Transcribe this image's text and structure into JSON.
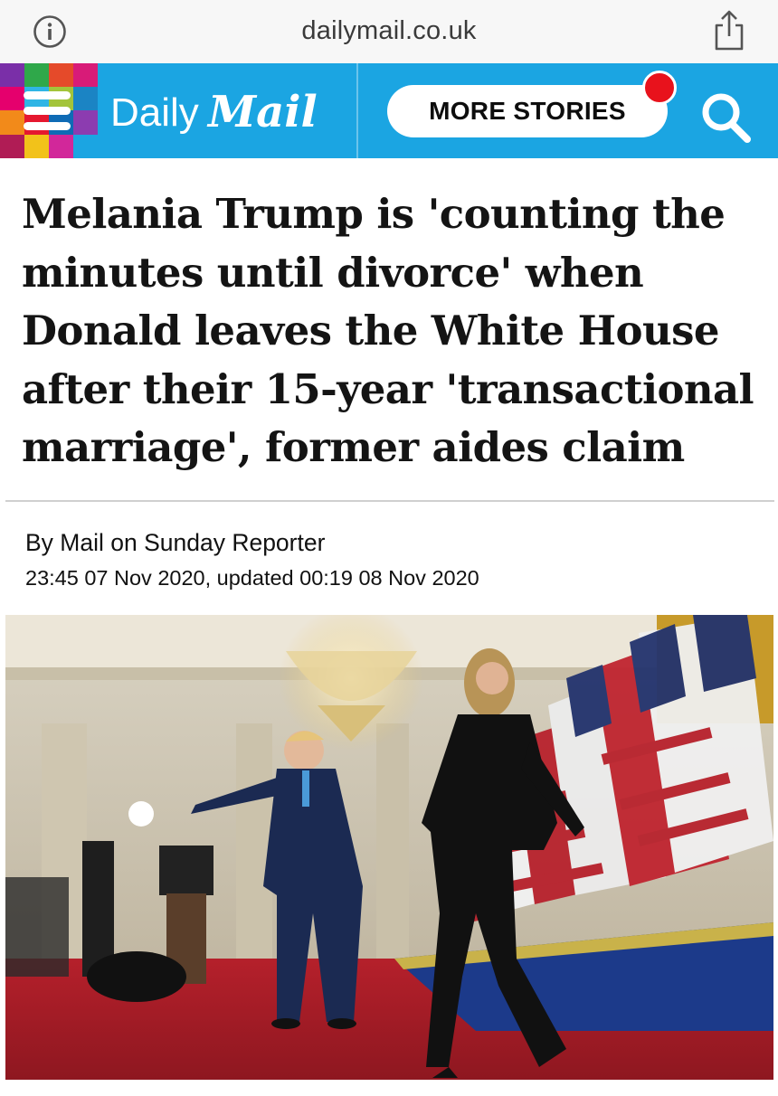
{
  "browser": {
    "url": "dailymail.co.uk"
  },
  "header": {
    "brand": "Daily Mail",
    "brand_part1": "Daily",
    "brand_part2": "Mail",
    "more_stories_label": "MORE STORIES",
    "accent_color": "#1ba5e2",
    "notification_color": "#e8121c",
    "icons": [
      "menu-icon",
      "search-icon",
      "info-icon",
      "share-icon"
    ]
  },
  "article": {
    "headline": "Melania Trump is 'counting the minutes until divorce' when Donald leaves the White House after their 15-year 'transactional marriage', former aides claim",
    "byline": "By Mail on Sunday Reporter",
    "dateline": "23:45 07 Nov 2020, updated 00:19 08 Nov 2020"
  }
}
